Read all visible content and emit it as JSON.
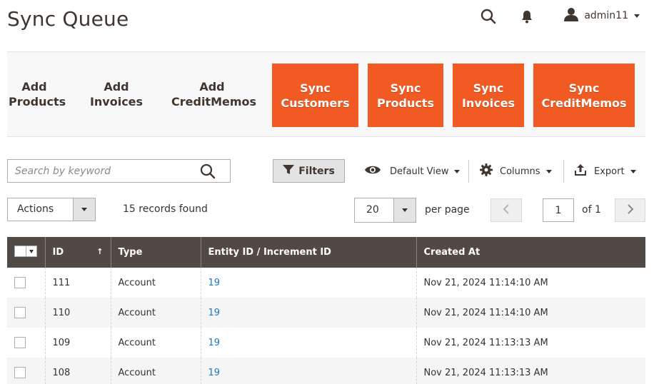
{
  "page": {
    "title": "Sync Queue"
  },
  "header": {
    "user_name": "admin11"
  },
  "actionbar": {
    "plain_buttons": [
      "Add\nProducts",
      "Add\nInvoices",
      "Add\nCreditMemos"
    ],
    "orange_buttons": [
      "Sync\nCustomers",
      "Sync\nProducts",
      "Sync\nInvoices",
      "Sync\nCreditMemos"
    ]
  },
  "toolbar": {
    "search_placeholder": "Search by keyword",
    "filters_label": "Filters",
    "view_label": "Default View",
    "columns_label": "Columns",
    "export_label": "Export"
  },
  "grid_controls": {
    "actions_label": "Actions",
    "records_found": "15 records found",
    "per_page_value": "20",
    "per_page_label": "per page",
    "page_value": "1",
    "page_of": "of 1"
  },
  "grid": {
    "columns": [
      "ID",
      "Type",
      "Entity ID / Increment ID",
      "Created At"
    ],
    "sort_arrow": "↑",
    "rows": [
      [
        "111",
        "Account",
        "19",
        "Nov 21, 2024 11:14:10 AM"
      ],
      [
        "110",
        "Account",
        "19",
        "Nov 21, 2024 11:14:10 AM"
      ],
      [
        "109",
        "Account",
        "19",
        "Nov 21, 2024 11:13:13 AM"
      ],
      [
        "108",
        "Account",
        "19",
        "Nov 21, 2024 11:13:13 AM"
      ]
    ]
  },
  "colors": {
    "accent": "#f15a22",
    "header_bg": "#514943",
    "link": "#1979c3"
  }
}
